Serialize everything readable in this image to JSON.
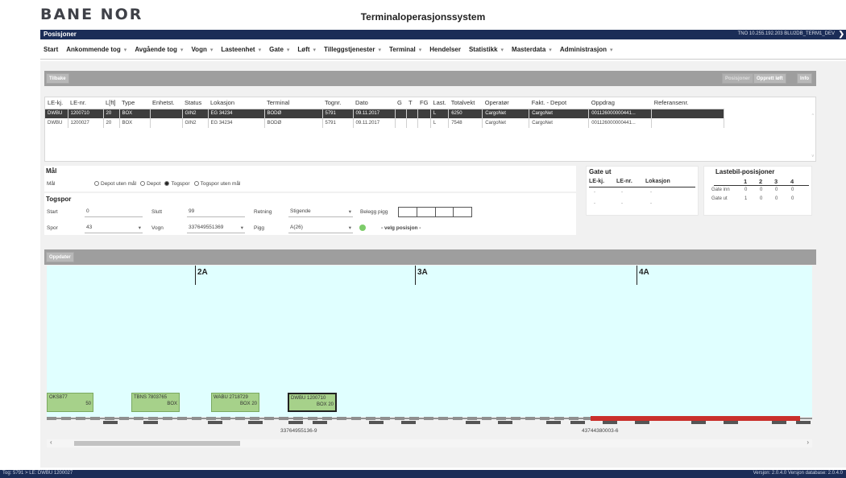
{
  "header": {
    "logo": "BANE NOR",
    "title": "Terminaloperasjonssystem"
  },
  "topbar": {
    "module": "Posisjoner",
    "connection": "TNO 10.255.192.203 BLU2DB_TERM1_DEV",
    "arrow": "❯"
  },
  "menu": [
    {
      "label": "Start",
      "dropdown": false
    },
    {
      "label": "Ankommende tog",
      "dropdown": true
    },
    {
      "label": "Avgående tog",
      "dropdown": true
    },
    {
      "label": "Vogn",
      "dropdown": true
    },
    {
      "label": "Lasteenhet",
      "dropdown": true
    },
    {
      "label": "Gate",
      "dropdown": true
    },
    {
      "label": "Løft",
      "dropdown": true
    },
    {
      "label": "Tilleggstjenester",
      "dropdown": true
    },
    {
      "label": "Terminal",
      "dropdown": true
    },
    {
      "label": "Hendelser",
      "dropdown": false
    },
    {
      "label": "Statistikk",
      "dropdown": true
    },
    {
      "label": "Masterdata",
      "dropdown": true
    },
    {
      "label": "Administrasjon",
      "dropdown": true
    }
  ],
  "dropdown_glyph": "▾",
  "toolbar1": {
    "back": "Tilbake",
    "position": "Posisjoner",
    "create_lift": "Opprett løft",
    "info": "Info"
  },
  "table": {
    "headers": [
      "LE-kj.",
      "LE-nr.",
      "L[ft]",
      "Type",
      "Enhetst.",
      "Status",
      "Lokasjon",
      "Terminal",
      "Tognr.",
      "Dato",
      "G",
      "T",
      "FG",
      "Last.",
      "Totalvekt",
      "Operatør",
      "Fakt. - Depot",
      "Oppdrag",
      "Referansenr."
    ],
    "rows": [
      [
        "DWBU",
        "1200710",
        "20",
        "BOX",
        "",
        "GIN2",
        "EG 34234",
        "BODØ",
        "5791",
        "09.11.2017",
        "",
        "",
        "",
        "L",
        "6250",
        "CargoNet",
        "CargoNet",
        "001126000000441...",
        ""
      ],
      [
        "DWBU",
        "1200027",
        "20",
        "BOX",
        "",
        "GIN2",
        "EG 34234",
        "BODØ",
        "5791",
        "09.11.2017",
        "",
        "",
        "",
        "L",
        "7548",
        "CargoNet",
        "CargoNet",
        "001126000000441...",
        ""
      ]
    ]
  },
  "mal": {
    "heading": "Mål",
    "label": "Mål",
    "options": [
      "Depot uten mål",
      "Depot",
      "Togspor",
      "Togspor uten mål"
    ],
    "selected_index": 2
  },
  "togspor": {
    "heading": "Togspor",
    "start_label": "Start",
    "start_value": "0",
    "slutt_label": "Slutt",
    "slutt_value": "99",
    "retning_label": "Retning",
    "retning_value": "Stigende",
    "belegg_label": "Belegg pigg",
    "spor_label": "Spor",
    "spor_value": "43",
    "vogn_label": "Vogn",
    "vogn_value": "337649551369",
    "pigg_label": "Pigg",
    "pigg_value": "A(26)",
    "status_text": "- velg posisjon -",
    "status_color": "#7dcc6a"
  },
  "gate_ut": {
    "heading": "Gate ut",
    "headers": [
      "LE-kj.",
      "LE-nr.",
      "Lokasjon"
    ],
    "rows": [
      [
        "-",
        "-",
        "-"
      ],
      [
        "-",
        "-",
        "-"
      ]
    ]
  },
  "lastebil": {
    "heading": "Lastebil-posisjoner",
    "cols": [
      "1",
      "2",
      "3",
      "4"
    ],
    "rows": [
      {
        "label": "Gate inn",
        "values": [
          "0",
          "0",
          "0",
          "0"
        ]
      },
      {
        "label": "Gate ut",
        "values": [
          "1",
          "0",
          "0",
          "0"
        ]
      }
    ]
  },
  "toolbar2": {
    "update": "Oppdater"
  },
  "track": {
    "markers": [
      "2A",
      "3A",
      "4A"
    ],
    "wagons": [
      {
        "line1": "OKS877",
        "line2": "50",
        "selected": false
      },
      {
        "line1": "TBNS 7803765",
        "line2": "BOX",
        "selected": false
      },
      {
        "line1": "WABU 2718729",
        "line2": "BOX 20",
        "selected": false
      },
      {
        "line1": "DWBU 1200710",
        "line2": "BOX 20",
        "selected": true
      }
    ],
    "wagon_numbers": [
      "33764955136-9",
      "43744380003-6"
    ]
  },
  "scroll": {
    "left": "‹",
    "right": "›"
  },
  "status": {
    "left": "Tog: 5791 > LE: DWBU 1200027",
    "right": "Versjon: 2.0.4.0 Versjon database: 2.0.4.0"
  }
}
